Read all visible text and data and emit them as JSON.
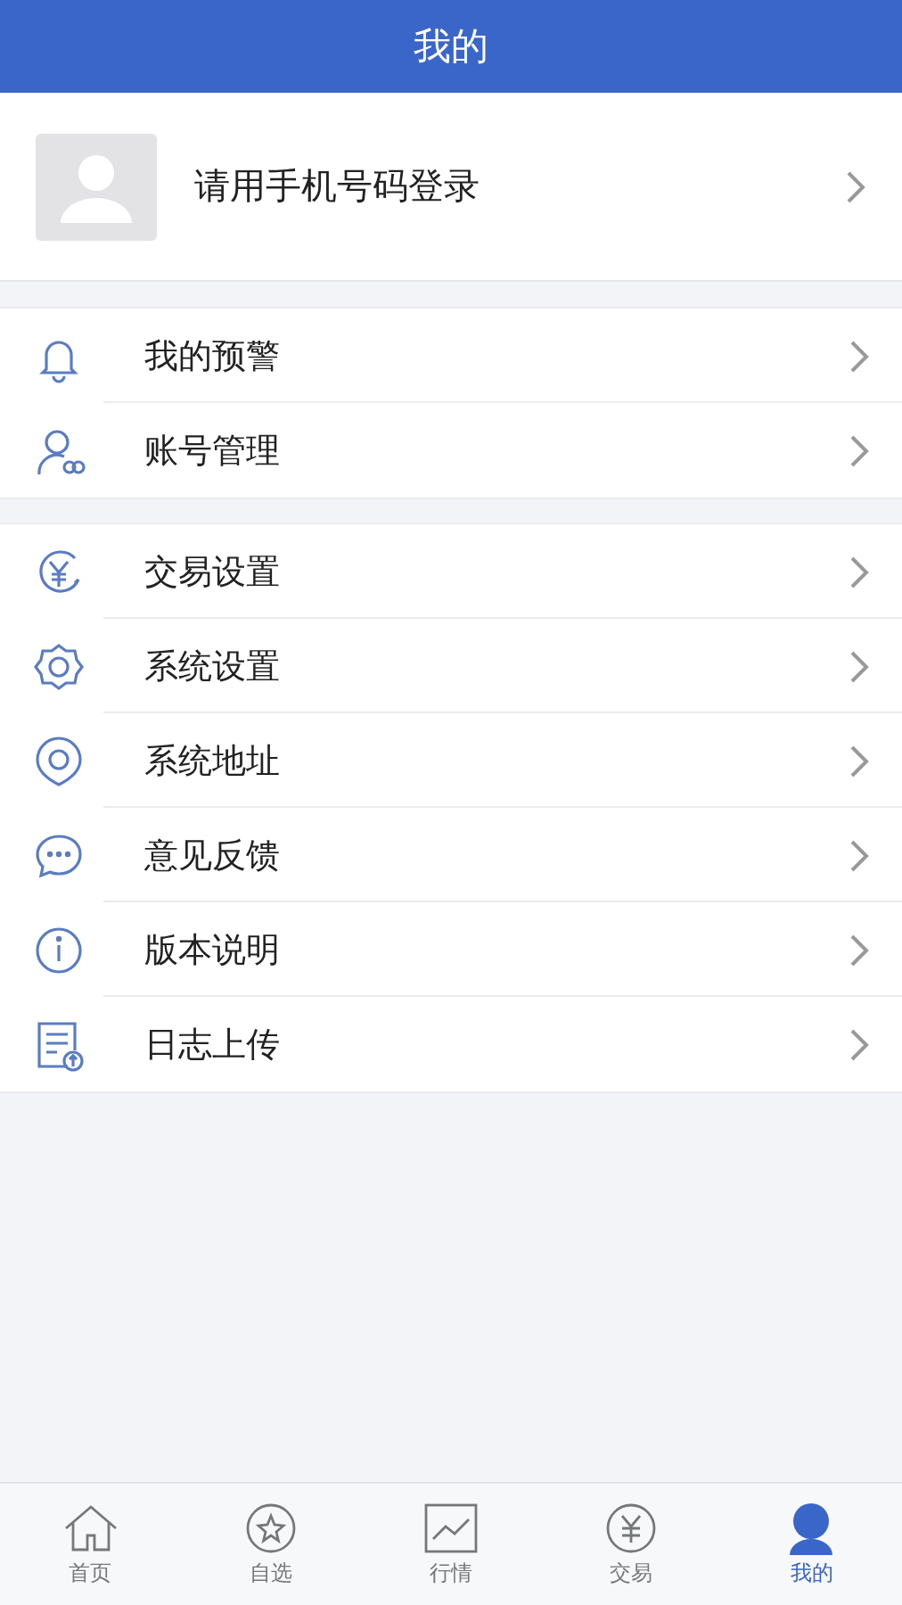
{
  "header": {
    "title": "我的"
  },
  "profile": {
    "login_text": "请用手机号码登录"
  },
  "groups": [
    {
      "items": [
        {
          "label": "我的预警"
        },
        {
          "label": "账号管理"
        }
      ]
    },
    {
      "items": [
        {
          "label": "交易设置"
        },
        {
          "label": "系统设置"
        },
        {
          "label": "系统地址"
        },
        {
          "label": "意见反馈"
        },
        {
          "label": "版本说明"
        },
        {
          "label": "日志上传"
        }
      ]
    }
  ],
  "tabs": [
    {
      "label": "首页",
      "selected": false
    },
    {
      "label": "自选",
      "selected": false
    },
    {
      "label": "行情",
      "selected": false
    },
    {
      "label": "交易",
      "selected": false
    },
    {
      "label": "我的",
      "selected": true
    }
  ]
}
